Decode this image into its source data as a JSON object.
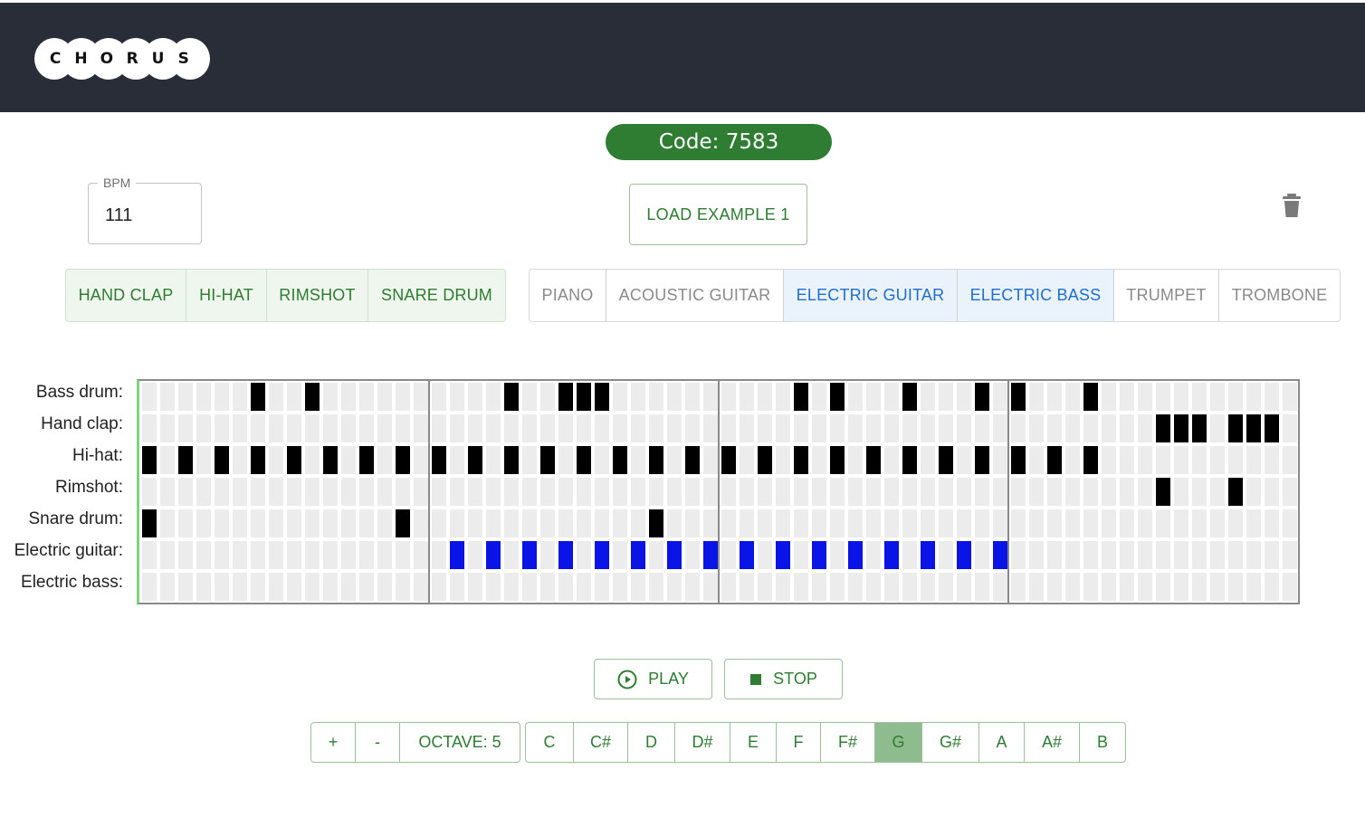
{
  "header": {
    "logo_letters": [
      "C",
      "H",
      "O",
      "R",
      "U",
      "S"
    ]
  },
  "session": {
    "code_label": "Code: 7583"
  },
  "controls": {
    "bpm_label": "BPM",
    "bpm_value": "111",
    "load_example_label": "LOAD EXAMPLE 1",
    "trash_icon": "trash-icon"
  },
  "percussion_buttons": [
    "HAND CLAP",
    "HI-HAT",
    "RIMSHOT",
    "SNARE DRUM"
  ],
  "instrument_buttons": [
    {
      "label": "PIANO",
      "active": false
    },
    {
      "label": "ACOUSTIC GUITAR",
      "active": false
    },
    {
      "label": "ELECTRIC GUITAR",
      "active": true
    },
    {
      "label": "ELECTRIC BASS",
      "active": true
    },
    {
      "label": "TRUMPET",
      "active": false
    },
    {
      "label": "TROMBONE",
      "active": false
    }
  ],
  "sequencer": {
    "steps": 64,
    "bars": 4,
    "rows": [
      {
        "label": "Bass drum:",
        "color": "#000000",
        "on": [
          6,
          9,
          20,
          23,
          24,
          25,
          36,
          38,
          42,
          46,
          48,
          52
        ]
      },
      {
        "label": "Hand clap:",
        "color": "#000000",
        "on": [
          56,
          57,
          58,
          60,
          61,
          62
        ]
      },
      {
        "label": "Hi-hat:",
        "color": "#000000",
        "on": [
          0,
          2,
          4,
          6,
          8,
          10,
          12,
          14,
          16,
          18,
          20,
          22,
          24,
          26,
          28,
          30,
          32,
          34,
          36,
          38,
          40,
          42,
          44,
          46,
          48,
          50,
          52
        ]
      },
      {
        "label": "Rimshot:",
        "color": "#000000",
        "on": [
          56,
          60
        ]
      },
      {
        "label": "Snare drum:",
        "color": "#000000",
        "on": [
          0,
          14,
          28
        ]
      },
      {
        "label": "Electric guitar:",
        "color": "#0a14e6",
        "on": [
          17,
          19,
          21,
          23,
          25,
          27,
          29,
          31,
          33,
          35,
          37,
          39,
          41,
          43,
          45,
          47
        ]
      },
      {
        "label": "Electric bass:",
        "color": "#000000",
        "on": []
      }
    ],
    "colors": {
      "empty": "#ececec",
      "bar_line": "#8a8a8a",
      "playhead": "#7fd37f"
    }
  },
  "transport": {
    "play_label": "PLAY",
    "stop_label": "STOP",
    "accent": "#2e7d32"
  },
  "octave": {
    "plus": "+",
    "minus": "-",
    "label": "OCTAVE: 5"
  },
  "keys": [
    {
      "label": "C",
      "selected": false
    },
    {
      "label": "C#",
      "selected": false
    },
    {
      "label": "D",
      "selected": false
    },
    {
      "label": "D#",
      "selected": false
    },
    {
      "label": "E",
      "selected": false
    },
    {
      "label": "F",
      "selected": false
    },
    {
      "label": "F#",
      "selected": false
    },
    {
      "label": "G",
      "selected": true
    },
    {
      "label": "G#",
      "selected": false
    },
    {
      "label": "A",
      "selected": false
    },
    {
      "label": "A#",
      "selected": false
    },
    {
      "label": "B",
      "selected": false
    }
  ]
}
